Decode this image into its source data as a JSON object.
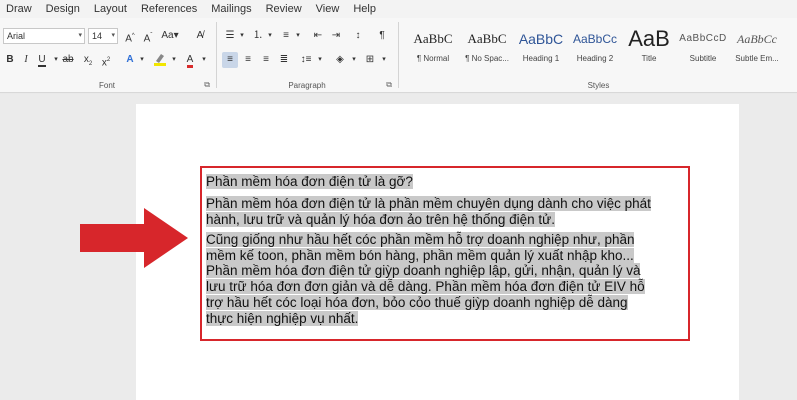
{
  "tabs": [
    "Draw",
    "Design",
    "Layout",
    "References",
    "Mailings",
    "Review",
    "View",
    "Help"
  ],
  "font": {
    "name": "Arial",
    "size": "14",
    "group_label": "Font"
  },
  "paragraph": {
    "group_label": "Paragraph"
  },
  "styles": {
    "group_label": "Styles",
    "items": [
      {
        "sample": "AaBbC",
        "name": "¶ Normal"
      },
      {
        "sample": "AaBbC",
        "name": "¶ No Spac..."
      },
      {
        "sample": "AaBbC",
        "name": "Heading 1"
      },
      {
        "sample": "AaBbCc",
        "name": "Heading 2"
      },
      {
        "sample": "AaB",
        "name": "Title"
      },
      {
        "sample": "AaBbCcD",
        "name": "Subtitle"
      },
      {
        "sample": "AaBbCc",
        "name": "Subtle Em..."
      }
    ]
  },
  "document": {
    "lines": [
      "Phần mềm hóa đơn điện tử là gỡ?",
      "Phần mềm hóa đơn điện tử là phần mềm chuyên dụng dành cho việc phát",
      "hành, lưu trữ và quản lý hóa đơn ảo trên hệ thống điện tử.",
      "Cũng giống như hầu hết cóc phần mềm hỗ trợ doanh nghiệp như, phần",
      "mềm kế toon, phần mềm bón hàng, phần mềm quản lý xuất nhập kho...",
      "Phần mềm hóa đơn điện tử giỳp doanh nghiệp lập, gửi, nhận, quản lý và",
      "lưu trữ hóa đơn đơn giản và dễ dàng. Phần mềm hóa đơn điện tử EIV hỗ",
      "trợ hầu hết cóc loại hóa đơn, bỏo cỏo thuế giỳp doanh nghiệp dễ dàng",
      "thực hiện nghiệp vụ nhất."
    ]
  },
  "colors": {
    "annotation": "#d7262b",
    "highlight": "#c9c9c9",
    "font_color": "#d92b2b",
    "highlight_color": "#f2e600"
  }
}
